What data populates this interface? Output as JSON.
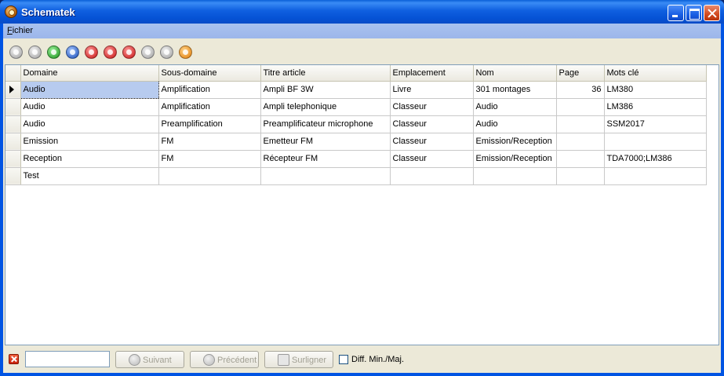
{
  "window": {
    "title": "Schematek"
  },
  "menu": {
    "file_label": "Fichier",
    "file_mnemonic": "F",
    "file_rest": "ichier"
  },
  "toolbar": {
    "buttons": [
      {
        "icon": "first-record-icon",
        "color": "gray"
      },
      {
        "icon": "previous-record-icon",
        "color": "gray"
      },
      {
        "icon": "next-record-icon",
        "color": "green"
      },
      {
        "icon": "last-record-icon",
        "color": "blue"
      },
      {
        "icon": "insert-record-icon",
        "color": "red"
      },
      {
        "icon": "delete-record-icon",
        "color": "red"
      },
      {
        "icon": "edit-record-icon",
        "color": "red"
      },
      {
        "icon": "post-edit-icon",
        "color": "gray"
      },
      {
        "icon": "cancel-edit-icon",
        "color": "gray"
      },
      {
        "icon": "refresh-data-icon",
        "color": "orange"
      }
    ]
  },
  "grid": {
    "columns": [
      "Domaine",
      "Sous-domaine",
      "Titre article",
      "Emplacement",
      "Nom",
      "Page",
      "Mots clé"
    ],
    "rows": [
      [
        "Audio",
        "Amplification",
        "Ampli BF 3W",
        "Livre",
        "301 montages",
        "36",
        "LM380"
      ],
      [
        "Audio",
        "Amplification",
        "Ampli telephonique",
        "Classeur",
        "Audio",
        "",
        "LM386"
      ],
      [
        "Audio",
        "Preamplification",
        "Preamplificateur microphone",
        "Classeur",
        "Audio",
        "",
        "SSM2017"
      ],
      [
        "Emission",
        "FM",
        "Emetteur FM",
        "Classeur",
        "Emission/Reception",
        "",
        ""
      ],
      [
        "Reception",
        "FM",
        "Récepteur FM",
        "Classeur",
        "Emission/Reception",
        "",
        "TDA7000;LM386"
      ],
      [
        "Test",
        "",
        "",
        "",
        "",
        "",
        ""
      ]
    ],
    "current_row": 0
  },
  "search": {
    "value": "",
    "next_label": "Suivant",
    "prev_label": "Précédent",
    "highlight_label": "Surligner",
    "case_label": "Diff. Min./Maj.",
    "case_checked": false
  },
  "colors": {
    "titlebar": "#0054e3",
    "selection": "#b7cbef",
    "menubar": "#a9c2ef"
  }
}
